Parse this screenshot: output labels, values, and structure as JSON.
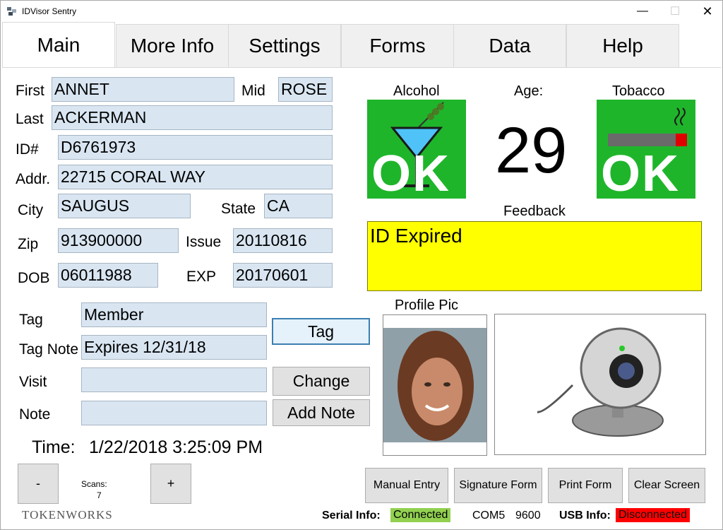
{
  "window": {
    "title": "IDVisor Sentry",
    "min": "—",
    "max": "☐",
    "close": "✕"
  },
  "tabs": [
    "Main",
    "More Info",
    "Settings",
    "Forms",
    "Data",
    "Help"
  ],
  "form": {
    "first_label": "First",
    "first": "ANNET",
    "mid_label": "Mid",
    "mid": "ROSE",
    "last_label": "Last",
    "last": "ACKERMAN",
    "id_label": "ID#",
    "id": "D6761973",
    "addr_label": "Addr.",
    "addr": "22715 CORAL WAY",
    "city_label": "City",
    "city": "SAUGUS",
    "state_label": "State",
    "state": "CA",
    "zip_label": "Zip",
    "zip": "913900000",
    "issue_label": "Issue",
    "issue": "20110816",
    "dob_label": "DOB",
    "dob": "06011988",
    "exp_label": "EXP",
    "exp": "20170601"
  },
  "tag_section": {
    "tag_label": "Tag",
    "tag": "Member",
    "tag_note_label": "Tag Note",
    "tag_note": "Expires 12/31/18",
    "visit_label": "Visit",
    "visit": "",
    "note_label": "Note",
    "note": "",
    "tag_button": "Tag",
    "change_button": "Change",
    "add_note_button": "Add Note"
  },
  "time": {
    "label": "Time:",
    "value": "1/22/2018 3:25:09 PM"
  },
  "scans": {
    "minus": "-",
    "plus": "+",
    "label": "Scans:",
    "count": "7"
  },
  "status": {
    "alcohol_label": "Alcohol",
    "alcohol_status": "OK",
    "age_label": "Age:",
    "age": "29",
    "tobacco_label": "Tobacco",
    "tobacco_status": "OK",
    "feedback_label": "Feedback",
    "feedback": "ID Expired",
    "profile_label": "Profile Pic"
  },
  "actions": {
    "manual_entry": "Manual Entry",
    "signature_form": "Signature Form",
    "print_form": "Print Form",
    "clear_screen": "Clear Screen"
  },
  "footer": {
    "logo": "TOKENWORKS",
    "serial_label": "Serial Info:",
    "serial_status": "Connected",
    "com_port": "COM5",
    "baud": "9600",
    "usb_label": "USB Info:",
    "usb_status": "Disconnected"
  },
  "colors": {
    "ok_green": "#1fb52b",
    "feedback_yellow": "#ffff00",
    "connected_green": "#92d050",
    "disconnected_red": "#ff0000",
    "field_blue": "#d9e6f2"
  }
}
